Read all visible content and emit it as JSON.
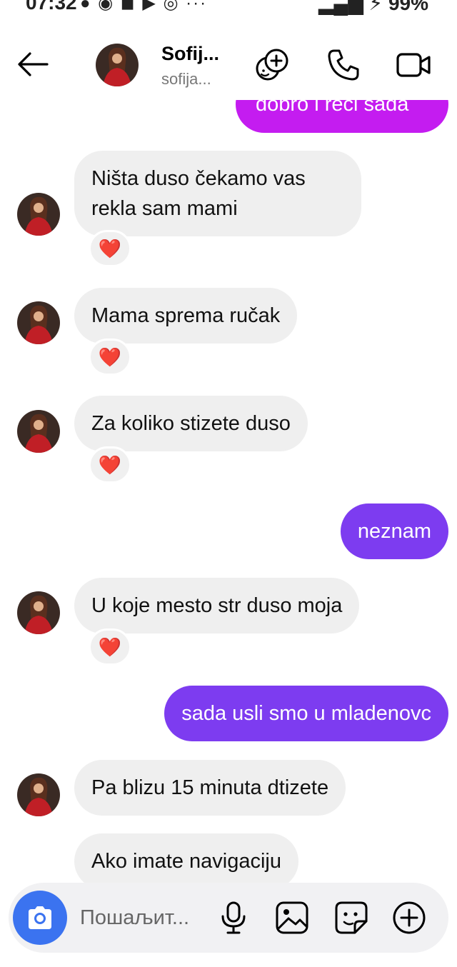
{
  "status": {
    "time": "07:32",
    "battery": "99%"
  },
  "header": {
    "name": "Sofij...",
    "handle": "sofija..."
  },
  "messages": [
    {
      "from": "me",
      "text": "dobro i reci sada"
    },
    {
      "from": "them",
      "text_line1": "Ništa duso čekamo vas",
      "text_line2": "rekla sam mami",
      "reaction": "❤️"
    },
    {
      "from": "them",
      "text": "Mama sprema ručak",
      "reaction": "❤️"
    },
    {
      "from": "them",
      "text": "Za koliko stizete duso",
      "reaction": "❤️"
    },
    {
      "from": "me",
      "text": "neznam"
    },
    {
      "from": "them",
      "text": "U koje mesto str duso moja",
      "reaction": "❤️"
    },
    {
      "from": "me",
      "text": "sada usli smo u mladenovc"
    },
    {
      "from": "them",
      "text": "Pa blizu 15 minuta dtizete"
    },
    {
      "from": "them",
      "text": "Ako imate navigaciju"
    }
  ],
  "composer": {
    "placeholder": "Пошаљит..."
  },
  "colors": {
    "outgoing": "#7d3cf0",
    "outgoing_top": "#c41cf0",
    "incoming": "#efefef",
    "camera_button": "#3b73f0"
  }
}
